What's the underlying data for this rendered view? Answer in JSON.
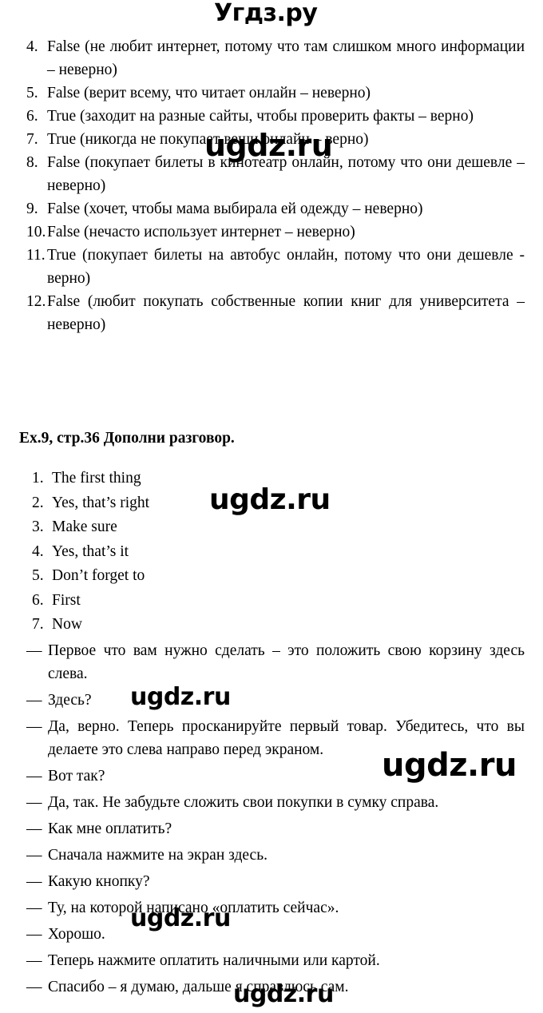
{
  "watermarks": {
    "top": "Угдз.ру",
    "body": "ugdz.ru"
  },
  "answers_section": {
    "items": [
      {
        "num": "4.",
        "text": "False (не любит интернет, потому что там слишком много информации – неверно)"
      },
      {
        "num": "5.",
        "text": "False (верит всему, что читает онлайн – неверно)"
      },
      {
        "num": "6.",
        "text": "True (заходит на разные сайты, чтобы проверить факты – верно)"
      },
      {
        "num": "7.",
        "text": "True (никогда не покупает вещи онлайн – верно)"
      },
      {
        "num": "8.",
        "text": "False (покупает билеты в кинотеатр онлайн, потому что они дешевле – неверно)"
      },
      {
        "num": "9.",
        "text": "False (хочет, чтобы мама выбирала ей одежду – неверно)"
      },
      {
        "num": "10.",
        "text": "False (нечасто использует интернет – неверно)"
      },
      {
        "num": "11.",
        "text": "True (покупает билеты на автобус онлайн, потому что они дешевле - верно)"
      },
      {
        "num": "12.",
        "text": "False (любит покупать собственные копии книг для университета – неверно)"
      }
    ]
  },
  "exercise": {
    "heading": "Ex.9, стр.36 Дополни разговор.",
    "answers": [
      {
        "num": "1.",
        "text": "The first thing"
      },
      {
        "num": "2.",
        "text": "Yes, that’s right"
      },
      {
        "num": "3.",
        "text": "Make sure"
      },
      {
        "num": "4.",
        "text": "Yes, that’s it"
      },
      {
        "num": "5.",
        "text": "Don’t forget to"
      },
      {
        "num": "6.",
        "text": "First"
      },
      {
        "num": "7.",
        "text": "Now"
      }
    ],
    "dialogue": [
      {
        "dash": "—",
        "text": "Первое что вам нужно сделать – это положить свою корзину здесь слева."
      },
      {
        "dash": "—",
        "text": "Здесь?"
      },
      {
        "dash": "—",
        "text": "Да, верно. Теперь просканируйте первый товар. Убедитесь, что вы делаете это слева направо перед экраном."
      },
      {
        "dash": "—",
        "text": "Вот так?"
      },
      {
        "dash": "—",
        "text": "Да, так. Не забудьте сложить свои покупки в сумку справа."
      },
      {
        "dash": "—",
        "text": "Как мне оплатить?"
      },
      {
        "dash": "—",
        "text": "Сначала нажмите на экран здесь."
      },
      {
        "dash": "—",
        "text": "Какую кнопку?"
      },
      {
        "dash": "—",
        "text": "Ту, на которой написано «оплатить сейчас»."
      },
      {
        "dash": "—",
        "text": "Хорошо."
      },
      {
        "dash": "—",
        "text": "Теперь нажмите оплатить наличными или картой."
      },
      {
        "dash": "—",
        "text": "Спасибо – я думаю, дальше я справлюсь сам."
      }
    ]
  }
}
